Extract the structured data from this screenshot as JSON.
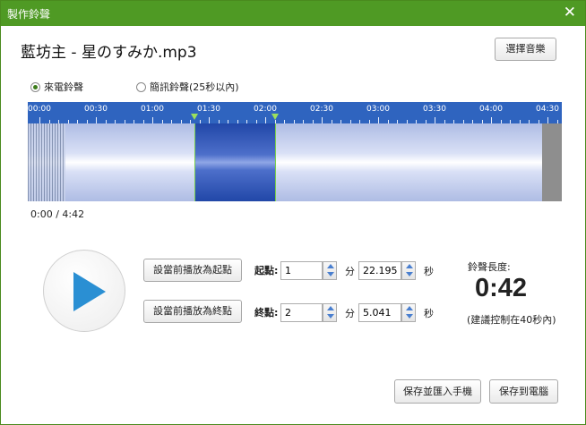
{
  "titlebar": {
    "title": "製作鈴聲",
    "close_icon": "close-icon"
  },
  "file": {
    "name": "藍坊主 - 星のすみか.mp3"
  },
  "select_button": "選擇音樂",
  "mode": {
    "options": [
      {
        "label": "來電鈴聲",
        "selected": true
      },
      {
        "label": "簡訊鈴聲(25秒以內)",
        "selected": false
      }
    ]
  },
  "waveform": {
    "tick_labels": [
      "00:00",
      "00:30",
      "01:00",
      "01:30",
      "02:00",
      "02:30",
      "03:00",
      "03:30",
      "04:00",
      "04:30"
    ],
    "selection_start_seconds": 82.195,
    "selection_end_seconds": 125.041,
    "total_seconds": 282,
    "colors": {
      "ruler": "#2f64bf",
      "selection": "#2147a8",
      "marker": "#7ad14a"
    }
  },
  "playback": {
    "time": "0:00 / 4:42",
    "play_icon": "play-icon"
  },
  "start": {
    "set_button": "設當前播放為起點",
    "label": "起點:",
    "minutes": "1",
    "minutes_unit": "分",
    "seconds": "22.195",
    "seconds_unit": "秒"
  },
  "end": {
    "set_button": "設當前播放為終點",
    "label": "終點:",
    "minutes": "2",
    "minutes_unit": "分",
    "seconds": "5.041",
    "seconds_unit": "秒"
  },
  "length": {
    "label": "鈴聲長度:",
    "value": "0:42",
    "hint": "(建議控制在40秒內)"
  },
  "footer": {
    "save_phone": "保存並匯入手機",
    "save_pc": "保存到電腦"
  }
}
